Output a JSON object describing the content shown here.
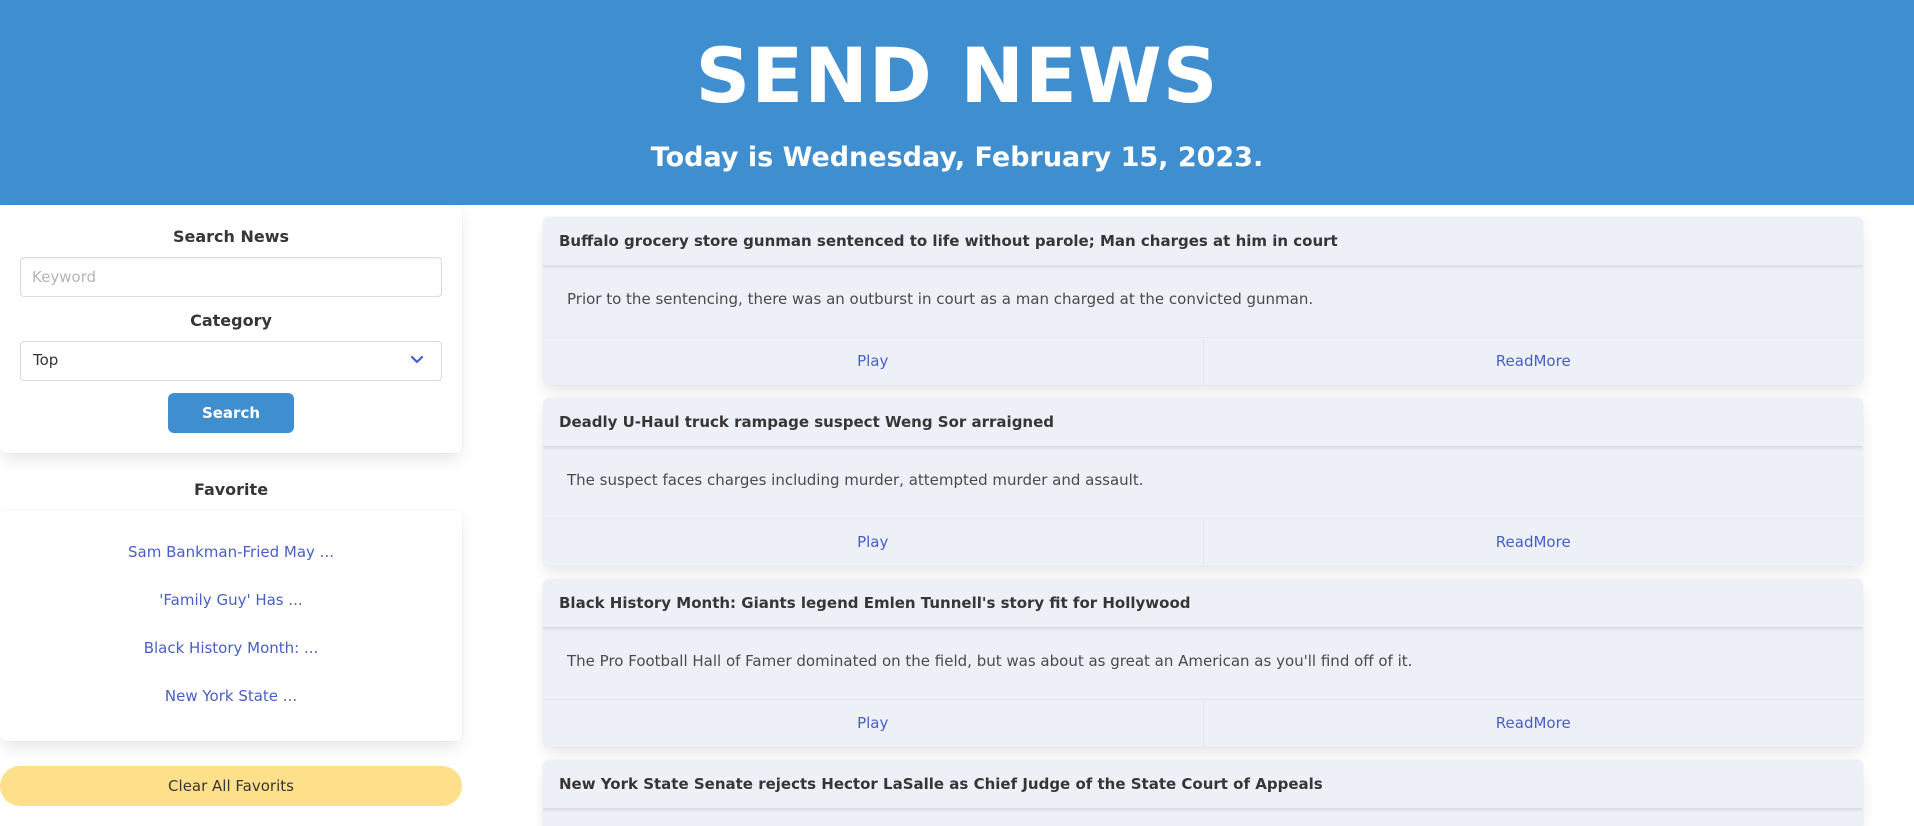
{
  "header": {
    "title": "SEND NEWS",
    "subtitle": "Today is Wednesday, February 15, 2023."
  },
  "search": {
    "heading": "Search News",
    "keyword_placeholder": "Keyword",
    "keyword_value": "",
    "category_label": "Category",
    "category_selected": "Top",
    "button_label": "Search"
  },
  "favorites": {
    "heading": "Favorite",
    "items": [
      {
        "label": "Sam Bankman-Fried May ..."
      },
      {
        "label": "'Family Guy' Has ..."
      },
      {
        "label": "Black History Month: ..."
      },
      {
        "label": "New York State ..."
      }
    ],
    "clear_label": "Clear All Favorits"
  },
  "news": [
    {
      "title": "Buffalo grocery store gunman sentenced to life without parole; Man charges at him in court",
      "summary": "Prior to the sentencing, there was an outburst in court as a man charged at the convicted gunman.",
      "play_label": "Play",
      "readmore_label": "ReadMore"
    },
    {
      "title": "Deadly U-Haul truck rampage suspect Weng Sor arraigned",
      "summary": "The suspect faces charges including murder, attempted murder and assault.",
      "play_label": "Play",
      "readmore_label": "ReadMore"
    },
    {
      "title": "Black History Month: Giants legend Emlen Tunnell's story fit for Hollywood",
      "summary": "The Pro Football Hall of Famer dominated on the field, but was about as great an American as you'll find off of it.",
      "play_label": "Play",
      "readmore_label": "ReadMore"
    },
    {
      "title": "New York State Senate rejects Hector LaSalle as Chief Judge of the State Court of Appeals"
    }
  ],
  "colors": {
    "primary": "#3e8ed0",
    "link": "#485fc7",
    "warning": "#ffe08a",
    "card_bg": "#eef0f8"
  },
  "icons": {
    "category_select": "chevron-down-icon"
  }
}
